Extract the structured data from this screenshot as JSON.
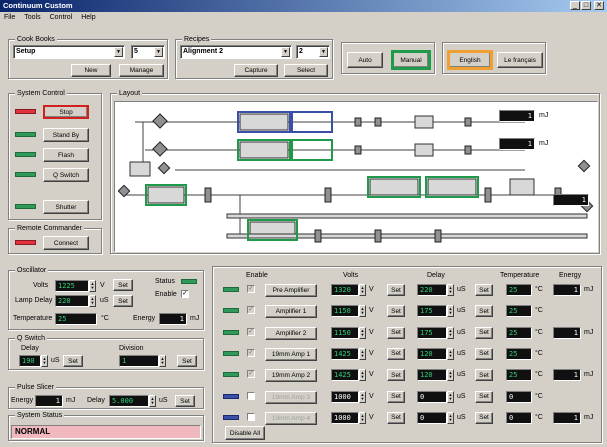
{
  "window": {
    "title": "Continuum Custom",
    "min": "_",
    "max": "□",
    "close": "✕"
  },
  "menu": [
    "File",
    "Tools",
    "Control",
    "Help"
  ],
  "cookbooks": {
    "label": "Cook Books",
    "selection": "Setup",
    "number": "5",
    "new_label": "New",
    "manage_label": "Manage"
  },
  "recipes": {
    "label": "Recipes",
    "selection": "Alignment 2",
    "number": "2",
    "capture_label": "Capture",
    "select_label": "Select"
  },
  "mode": {
    "auto": "Auto",
    "manual": "Manual"
  },
  "language": {
    "english": "English",
    "french": "Le français"
  },
  "system_control": {
    "label": "System Control",
    "buttons": [
      "Stop",
      "Stand By",
      "Flash",
      "Q Switch",
      "Shutter"
    ]
  },
  "remote": {
    "label": "Remote Commander",
    "connect": "Connect"
  },
  "layout": {
    "label": "Layout",
    "mj": [
      "1",
      "1",
      "1"
    ],
    "unit": "mJ"
  },
  "oscillator": {
    "label": "Oscillator",
    "volts_label": "Volts",
    "volts": "1225",
    "volts_unit": "V",
    "set": "Set",
    "status_label": "Status",
    "lamp_delay_label": "Lamp Delay",
    "lamp_delay": "220",
    "lamp_delay_unit": "uS",
    "enable_label": "Enable",
    "enable_check": "✓",
    "temperature_label": "Temperature",
    "temperature": "25",
    "temperature_unit": "°C",
    "energy_label": "Energy",
    "energy": "1",
    "energy_unit": "mJ"
  },
  "qswitch": {
    "label": "Q Switch",
    "delay_label": "Delay",
    "delay": "190",
    "delay_unit": "uS",
    "set": "Set",
    "division_label": "Division",
    "division": "1"
  },
  "pulse_slicer": {
    "label": "Pulse Slicer",
    "energy_label": "Energy",
    "energy": "1",
    "energy_unit": "mJ",
    "delay_label": "Delay",
    "delay": "5.000",
    "delay_unit": "uS",
    "set": "Set"
  },
  "system_status": {
    "label": "System Status",
    "value": "NORMAL"
  },
  "amps": {
    "headers": {
      "enable": "Enable",
      "volts": "Volts",
      "delay": "Delay",
      "temperature": "Temperature",
      "energy": "Energy"
    },
    "volt_unit": "V",
    "delay_unit": "uS",
    "temp_unit": "°C",
    "energy_unit": "mJ",
    "set": "Set",
    "check": "✓",
    "rows": [
      {
        "name": "Pre Amplifier",
        "volts": "1320",
        "delay": "220",
        "temp": "25",
        "energy": "1",
        "enabled": true,
        "has_energy": true
      },
      {
        "name": "Amplifier 1",
        "volts": "1150",
        "delay": "175",
        "temp": "25",
        "energy": "",
        "enabled": true,
        "has_energy": false
      },
      {
        "name": "Amplifier 2",
        "volts": "1150",
        "delay": "175",
        "temp": "25",
        "energy": "1",
        "enabled": true,
        "has_energy": true
      },
      {
        "name": "19mm Amp 1",
        "volts": "1425",
        "delay": "120",
        "temp": "25",
        "energy": "",
        "enabled": true,
        "has_energy": false
      },
      {
        "name": "19mm Amp 2",
        "volts": "1425",
        "delay": "120",
        "temp": "25",
        "energy": "1",
        "enabled": true,
        "has_energy": true
      },
      {
        "name": "19mm Amp 3",
        "volts": "1000",
        "delay": "0",
        "temp": "0",
        "energy": "",
        "enabled": false,
        "has_energy": false
      },
      {
        "name": "19mm Amp 4",
        "volts": "1000",
        "delay": "0",
        "temp": "0",
        "energy": "1",
        "enabled": false,
        "has_energy": true
      }
    ],
    "disable_all": "Disable All"
  },
  "colors": {
    "led_green": "#2f9a5a",
    "led_red": "#e2323c",
    "led_blue": "#3a4fa8",
    "stop_border": "#d02020",
    "manual_border": "#1e9a4a",
    "english_border": "#f0a030",
    "status_bg": "#f2b8c0"
  }
}
